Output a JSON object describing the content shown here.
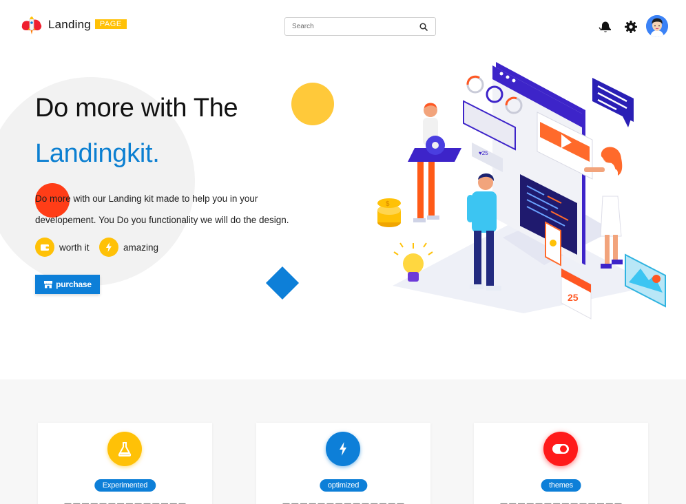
{
  "header": {
    "brand_name": "Landing",
    "brand_badge": "PAGE",
    "search_placeholder": "Search",
    "icons": [
      "rocket-logo-icon",
      "search-icon",
      "notification-bell-icon",
      "gear-icon",
      "user-avatar"
    ]
  },
  "hero": {
    "title": "Do more with The",
    "title_accent": "Landingkit.",
    "description": "Do more with our Landing kit made to help you in your developement. You Do you functionality we will do the design.",
    "features": [
      {
        "label": "worth it",
        "icon": "wallet-icon"
      },
      {
        "label": "amazing",
        "icon": "lightning-icon"
      }
    ],
    "purchase_label": "purchase",
    "purchase_icon": "store-icon"
  },
  "cards": [
    {
      "title": "Experimented",
      "icon": "flask-icon",
      "color": "#ffc107"
    },
    {
      "title": "optimized",
      "icon": "lightning-icon",
      "color": "#0d7fd8"
    },
    {
      "title": "themes",
      "icon": "toggle-icon",
      "color": "#ff1a1a"
    }
  ],
  "colors": {
    "accent_blue": "#0b7fd1",
    "yellow": "#ffc107",
    "red": "#ff3d17",
    "section_bg": "#f7f7f7"
  }
}
